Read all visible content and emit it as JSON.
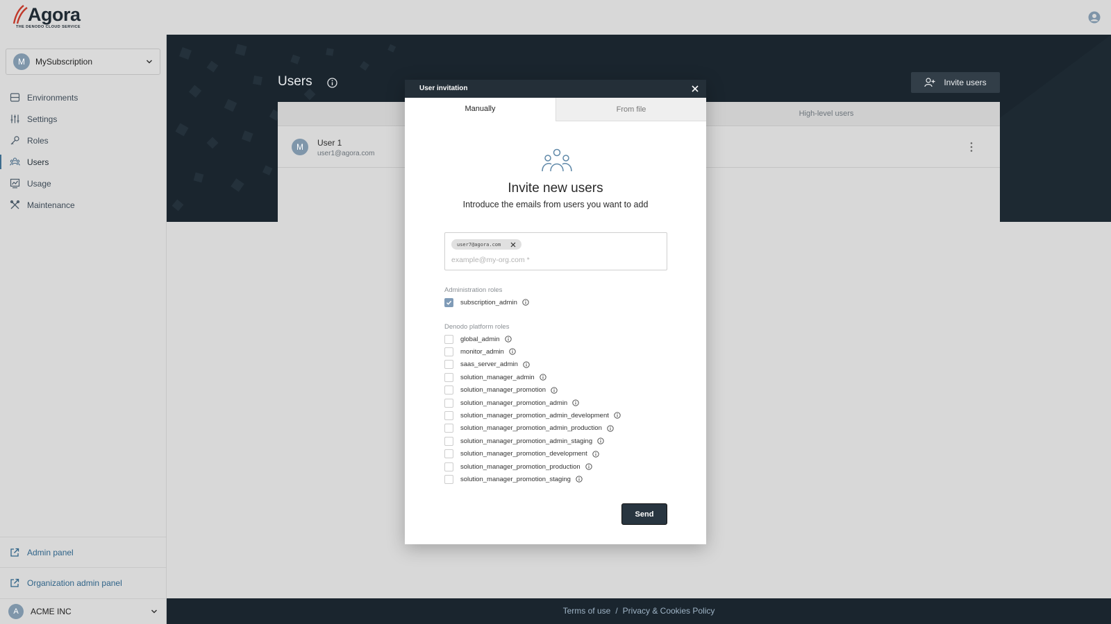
{
  "brand": {
    "name": "Agora",
    "tagline": "THE DENODO CLOUD SERVICE",
    "accent": "#c0392b"
  },
  "header": {
    "user_icon": "user-circle-icon"
  },
  "sidebar": {
    "subscription": {
      "initial": "M",
      "name": "MySubscription"
    },
    "items": [
      {
        "label": "Environments",
        "icon": "server-icon"
      },
      {
        "label": "Settings",
        "icon": "sliders-icon"
      },
      {
        "label": "Roles",
        "icon": "key-icon"
      },
      {
        "label": "Users",
        "icon": "users-icon",
        "active": true
      },
      {
        "label": "Usage",
        "icon": "chart-icon"
      },
      {
        "label": "Maintenance",
        "icon": "tools-icon"
      }
    ],
    "admin_panel": "Admin panel",
    "org_admin_panel": "Organization admin panel",
    "org": {
      "initial": "A",
      "name": "ACME INC"
    }
  },
  "main": {
    "title": "Users",
    "invite_button": "Invite users",
    "tab_high_level": "High-level users",
    "user": {
      "initial": "M",
      "name": "User 1",
      "email": "user1@agora.com"
    }
  },
  "footer": {
    "terms": "Terms of use",
    "separator": "/",
    "privacy": "Privacy & Cookies Policy"
  },
  "modal": {
    "title": "User invitation",
    "tab_manual": "Manually",
    "tab_file": "From file",
    "heading": "Invite new users",
    "subheading": "Introduce the emails from users you want to add",
    "chip_email": "user7@agora.com",
    "email_placeholder": "example@my-org.com *",
    "admin_roles_label": "Administration roles",
    "admin_roles": [
      {
        "name": "subscription_admin",
        "checked": true
      }
    ],
    "platform_roles_label": "Denodo platform roles",
    "platform_roles": [
      {
        "name": "global_admin",
        "checked": false
      },
      {
        "name": "monitor_admin",
        "checked": false
      },
      {
        "name": "saas_server_admin",
        "checked": false
      },
      {
        "name": "solution_manager_admin",
        "checked": false
      },
      {
        "name": "solution_manager_promotion",
        "checked": false
      },
      {
        "name": "solution_manager_promotion_admin",
        "checked": false
      },
      {
        "name": "solution_manager_promotion_admin_development",
        "checked": false
      },
      {
        "name": "solution_manager_promotion_admin_production",
        "checked": false
      },
      {
        "name": "solution_manager_promotion_admin_staging",
        "checked": false
      },
      {
        "name": "solution_manager_promotion_development",
        "checked": false
      },
      {
        "name": "solution_manager_promotion_production",
        "checked": false
      },
      {
        "name": "solution_manager_promotion_staging",
        "checked": false
      }
    ],
    "send_button": "Send"
  }
}
